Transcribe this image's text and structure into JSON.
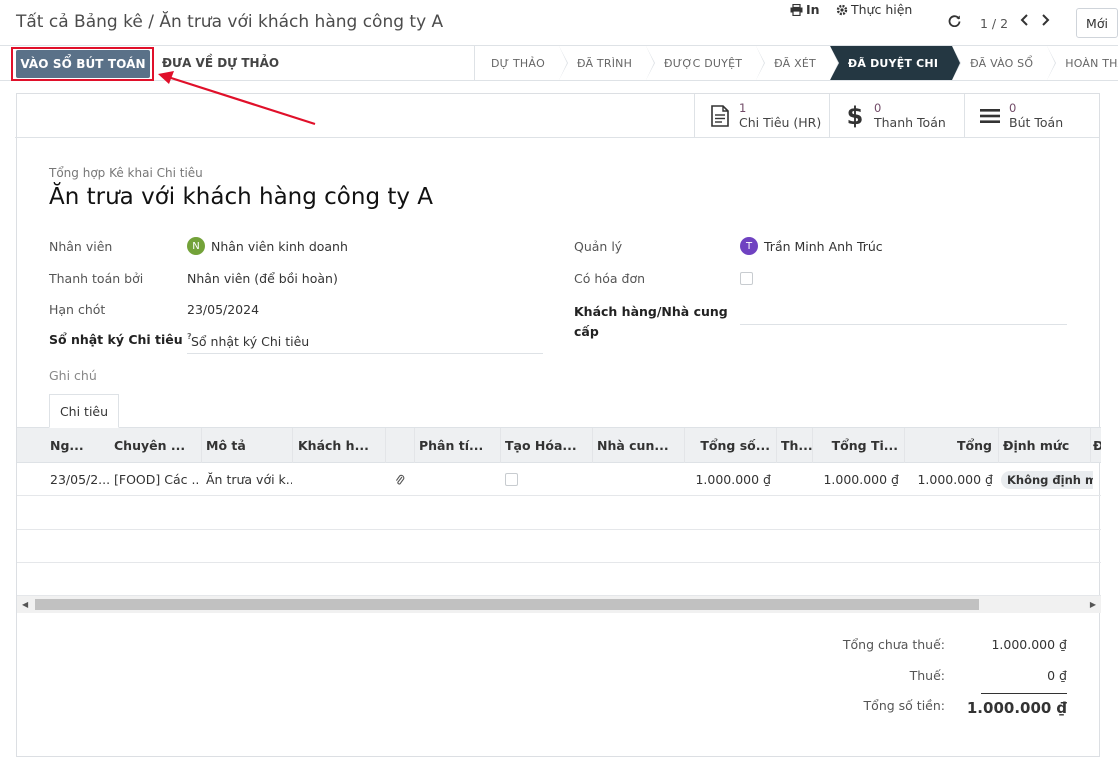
{
  "breadcrumb": {
    "parent": "Tất cả Bảng kê",
    "separator": " / ",
    "current": "Ăn trưa với khách hàng công ty A"
  },
  "toolbar": {
    "print_label": "In",
    "action_label": "Thực hiện",
    "pager": "1 / 2",
    "new_label": "Mới"
  },
  "status_buttons": {
    "post_label": "VÀO SỔ BÚT TOÁN",
    "draft_label": "ĐƯA VỀ DỰ THẢO"
  },
  "stages": [
    "DỰ THẢO",
    "ĐÃ TRÌNH",
    "ĐƯỢC DUYỆT",
    "ĐÃ XÉT",
    "ĐÃ DUYỆT CHI",
    "ĐÃ VÀO SỔ",
    "HOÀN THÀNH"
  ],
  "active_stage": "ĐÃ DUYỆT CHI",
  "smart_buttons": [
    {
      "value": "1",
      "label": "Chi Tiêu (HR)",
      "icon": "document-icon"
    },
    {
      "value": "0",
      "label": "Thanh Toán",
      "icon": "dollar-icon"
    },
    {
      "value": "0",
      "label": "Bút Toán",
      "icon": "list-icon"
    }
  ],
  "form": {
    "model_label": "Tổng hợp Kê khai Chi tiêu",
    "title": "Ăn trưa với khách hàng công ty A",
    "employee_label": "Nhân viên",
    "employee_value": "Nhân viên kinh doanh",
    "employee_initial": "N",
    "paid_by_label": "Thanh toán bởi",
    "paid_by_value": "Nhân viên (để bồi hoàn)",
    "deadline_label": "Hạn chót",
    "deadline_value": "23/05/2024",
    "journal_label": "Sổ nhật ký Chi tiêu",
    "journal_help": "?",
    "journal_value": "Sổ nhật ký Chi tiêu",
    "manager_label": "Quản lý",
    "manager_value": "Trần Minh Anh Trúc",
    "manager_initial": "T",
    "invoice_label": "Có hóa đơn",
    "vendor_label_1": "Khách hàng/Nhà cung",
    "vendor_label_2": "cấp",
    "notes_label": "Ghi chú"
  },
  "tab": {
    "label": "Chi tiêu"
  },
  "table": {
    "headers": [
      "Ng...",
      "Chuyên ...",
      "Mô tả",
      "Khách h...",
      "Phân tí...",
      "Tạo Hóa...",
      "Nhà cun...",
      "Tổng số...",
      "Th...",
      "Tổng Ti...",
      "Tổng",
      "Định mức",
      "Đ"
    ],
    "row": {
      "date": "23/05/2...",
      "category": "[FOOD] Các ...",
      "description": "Ăn trưa với k...",
      "total_untaxed": "1.000.000 ₫",
      "total_currency": "1.000.000 ₫",
      "total": "1.000.000 ₫",
      "policy": "Không định mú"
    }
  },
  "totals": {
    "untaxed_label": "Tổng chưa thuế:",
    "untaxed_value": "1.000.000 ₫",
    "tax_label": "Thuế:",
    "tax_value": "0 ₫",
    "total_label": "Tổng số tiền:",
    "total_value": "1.000.000 ₫"
  },
  "colors": {
    "primary": "#5a7188",
    "active_stage": "#243742",
    "highlight": "#e0102a",
    "employee_avatar": "#73a239",
    "manager_avatar": "#6f42c1",
    "smart_value": "#714b67"
  }
}
